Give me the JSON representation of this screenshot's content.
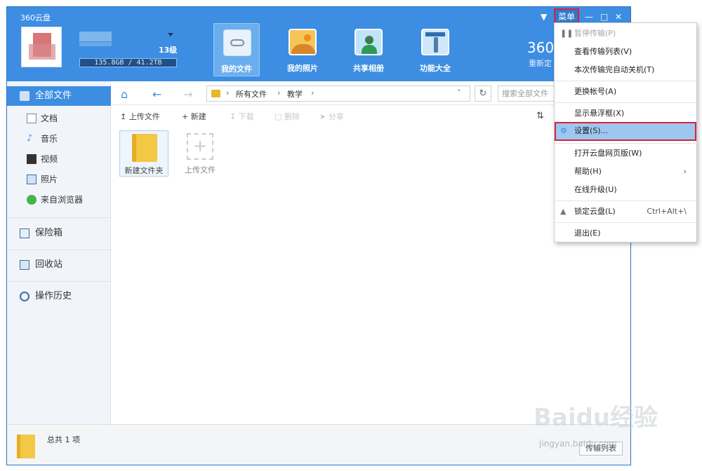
{
  "app": {
    "title": "360云盘"
  },
  "user": {
    "level": "13级",
    "quota": "135.8GB / 41.2TB"
  },
  "header_nav": [
    {
      "label": "我的文件",
      "active": true
    },
    {
      "label": "我的照片",
      "active": false
    },
    {
      "label": "共享相册",
      "active": false
    },
    {
      "label": "功能大全",
      "active": false
    }
  ],
  "header_right": {
    "stat": "360",
    "sub": "重新定"
  },
  "title_bar": {
    "menu_label": "菜单"
  },
  "sidebar": {
    "all_files": "全部文件",
    "docs": "文档",
    "music": "音乐",
    "video": "视频",
    "photos": "照片",
    "browser": "来自浏览器",
    "safe": "保险箱",
    "recycle": "回收站",
    "history": "操作历史"
  },
  "breadcrumb": [
    "所有文件",
    "教学"
  ],
  "search": {
    "placeholder": "搜索全部文件"
  },
  "actions": {
    "upload": "上传文件",
    "new": "新建",
    "download": "下载",
    "delete": "删除",
    "share": "分享"
  },
  "files": [
    {
      "name": "新建文件夹"
    },
    {
      "name": "上传文件"
    }
  ],
  "status": {
    "count": "总共 1 项",
    "transfer": "传输列表"
  },
  "context_menu": {
    "pause": "暂停传输(P)",
    "view_list": "查看传输列表(V)",
    "shutdown": "本次传输完自动关机(T)",
    "switch_account": "更换帐号(A)",
    "float": "显示悬浮框(X)",
    "settings": "设置(S)...",
    "open_web": "打开云盘网页版(W)",
    "help": "帮助(H)",
    "upgrade": "在线升级(U)",
    "lock": "锁定云盘(L)",
    "lock_shortcut": "Ctrl+Alt+\\",
    "exit": "退出(E)"
  },
  "watermark": {
    "brand": "Baidu经验",
    "url": "jingyan.baidu.com"
  },
  "colors": {
    "header": "#3d8ee2",
    "highlight_border": "#d6223a",
    "selected_menu": "#9dc7f0"
  }
}
